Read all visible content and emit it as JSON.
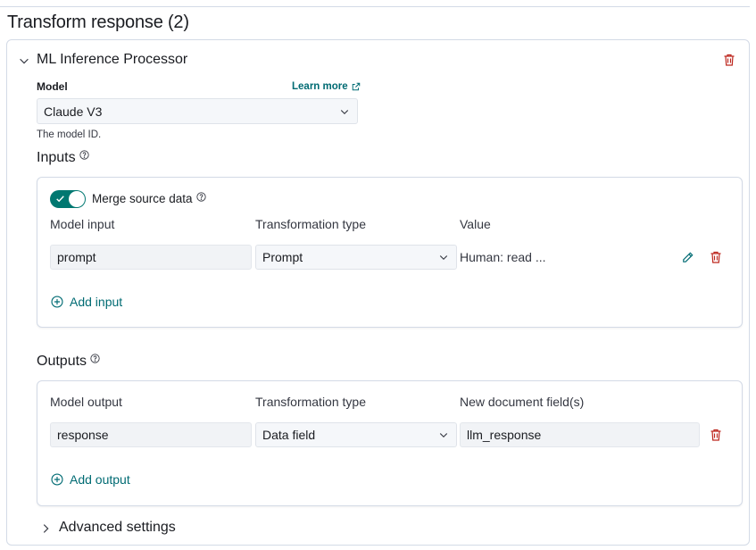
{
  "section": {
    "title": "Transform response (2)"
  },
  "processor": {
    "title": "ML Inference Processor",
    "model_label": "Model",
    "learn_more": "Learn more",
    "model_value": "Claude V3",
    "model_help": "The model ID."
  },
  "inputs": {
    "heading": "Inputs",
    "merge_label": "Merge source data",
    "merge_enabled": true,
    "columns": [
      "Model input",
      "Transformation type",
      "Value"
    ],
    "rows": [
      {
        "model_input": "prompt",
        "transformation_type": "Prompt",
        "value": "Human: read ..."
      }
    ],
    "add_label": "Add input"
  },
  "outputs": {
    "heading": "Outputs",
    "columns": [
      "Model output",
      "Transformation type",
      "New document field(s)"
    ],
    "rows": [
      {
        "model_output": "response",
        "transformation_type": "Data field",
        "new_field": "llm_response"
      }
    ],
    "add_label": "Add output"
  },
  "advanced": {
    "label": "Advanced settings"
  },
  "icons": {
    "collapse": "chevron-down-icon",
    "expand": "chevron-right-icon",
    "delete": "trash-icon",
    "external": "external-link-icon",
    "help": "question-circle-icon",
    "edit": "pencil-icon",
    "add": "plus-circle-icon",
    "toggle_check": "check-icon"
  },
  "colors": {
    "accent": "#007871",
    "link": "#006b73",
    "danger": "#bd271e",
    "border": "#d3dae6",
    "field_bg": "#f1f3f6"
  }
}
